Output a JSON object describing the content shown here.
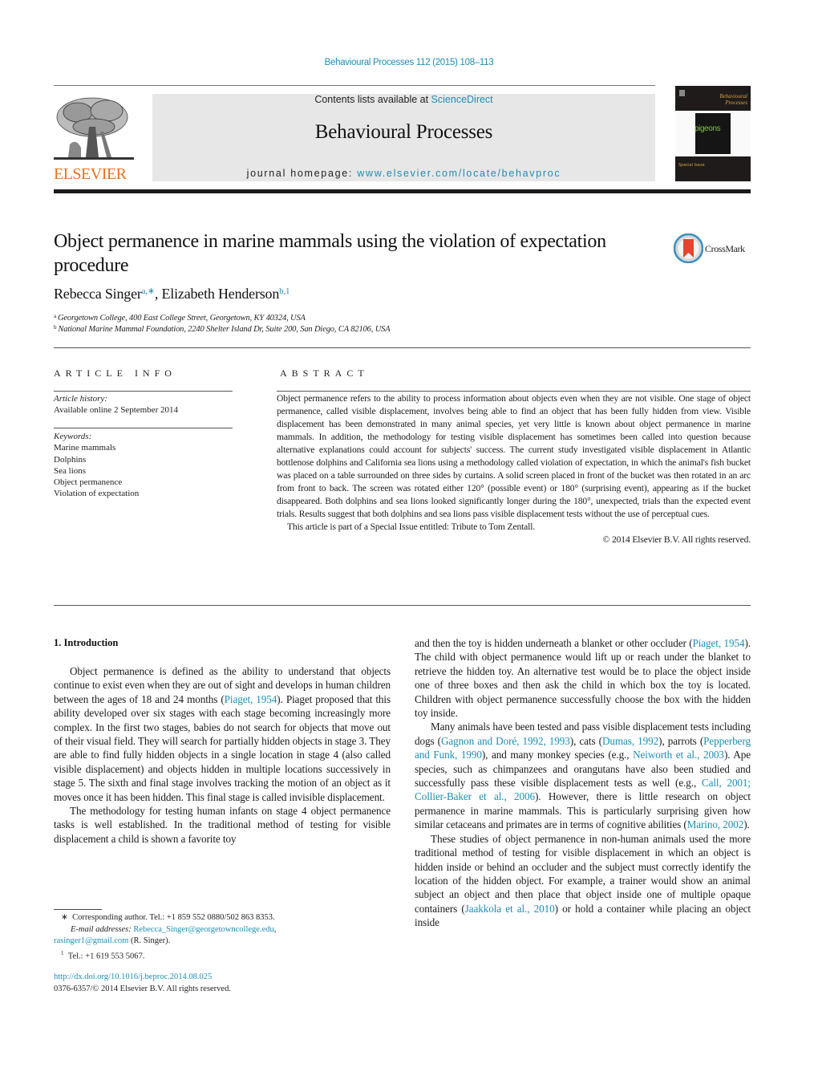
{
  "header": {
    "journal_citation": "Behavioural Processes 112 (2015) 108–113",
    "contents_prefix": "Contents lists available at ",
    "contents_link": "ScienceDirect",
    "journal_name": "Behavioural Processes",
    "homepage_prefix": "journal homepage: ",
    "homepage_link": "www.elsevier.com/locate/behavproc",
    "publisher_logo_text": "ELSEVIER",
    "cover": {
      "title_line1": "Behavioural",
      "title_line2": "Processes",
      "cover_word": "pigeons",
      "special_issue": "Special Issue"
    },
    "colors": {
      "link": "#1f8db5",
      "elsevier_orange": "#e9711c",
      "masthead_bg": "#e7e7e7"
    }
  },
  "article": {
    "title": "Object permanence in marine mammals using the violation of expectation procedure",
    "crossmark_label": "CrossMark",
    "authors": [
      {
        "name": "Rebecca Singer",
        "marks": "a,∗"
      },
      {
        "name": "Elizabeth Henderson",
        "marks": "b,1"
      }
    ],
    "author_separator": ", ",
    "affiliations": [
      {
        "mark": "a",
        "text": "Georgetown College, 400 East College Street, Georgetown, KY 40324, USA"
      },
      {
        "mark": "b",
        "text": "National Marine Mammal Foundation, 2240 Shelter Island Dr, Suite 200, San Diego, CA 82106, USA"
      }
    ]
  },
  "article_info": {
    "label": "ARTICLE INFO",
    "history_label": "Article history:",
    "history_value": "Available online 2 September 2014",
    "keywords_label": "Keywords:",
    "keywords": [
      "Marine mammals",
      "Dolphins",
      "Sea lions",
      "Object permanence",
      "Violation of expectation"
    ]
  },
  "abstract": {
    "label": "ABSTRACT",
    "body": "Object permanence refers to the ability to process information about objects even when they are not visible. One stage of object permanence, called visible displacement, involves being able to find an object that has been fully hidden from view. Visible displacement has been demonstrated in many animal species, yet very little is known about object permanence in marine mammals. In addition, the methodology for testing visible displacement has sometimes been called into question because alternative explanations could account for subjects' success. The current study investigated visible displacement in Atlantic bottlenose dolphins and California sea lions using a methodology called violation of expectation, in which the animal's fish bucket was placed on a table surrounded on three sides by curtains. A solid screen placed in front of the bucket was then rotated in an arc from front to back. The screen was rotated either 120° (possible event) or 180° (surprising event), appearing as if the bucket disappeared. Both dolphins and sea lions looked significantly longer during the 180°, unexpected, trials than the expected event trials. Results suggest that both dolphins and sea lions pass visible displacement tests without the use of perceptual cues.",
    "special_issue": "This article is part of a Special Issue entitled: Tribute to Tom Zentall.",
    "copyright": "© 2014 Elsevier B.V. All rights reserved."
  },
  "introduction": {
    "heading": "1.  Introduction",
    "left_column": [
      [
        {
          "t": "Object permanence is defined as the ability to understand that objects continue to exist even when they are out of sight and develops in human children between the ages of 18 and 24 months ("
        },
        {
          "t": "Piaget, 1954",
          "link": true
        },
        {
          "t": "). Piaget proposed that this ability developed over six stages with each stage becoming increasingly more complex. In the first two stages, babies do not search for objects that move out of their visual field. They will search for partially hidden objects in stage 3. They are able to find fully hidden objects in a single location in stage 4 (also called visible displacement) and objects hidden in multiple locations successively in stage 5. The sixth and final stage involves tracking the motion of an object as it moves once it has been hidden. This final stage is called invisible displacement."
        }
      ],
      [
        {
          "t": "The methodology for testing human infants on stage 4 object permanence tasks is well established. In the traditional method of testing for visible displacement a child is shown a favorite toy"
        }
      ]
    ],
    "right_column": [
      [
        {
          "t": "and then the toy is hidden underneath a blanket or other occluder ("
        },
        {
          "t": "Piaget, 1954",
          "link": true
        },
        {
          "t": "). The child with object permanence would lift up or reach under the blanket to retrieve the hidden toy. An alternative test would be to place the object inside one of three boxes and then ask the child in which box the toy is located. Children with object permanence successfully choose the box with the hidden toy inside."
        }
      ],
      [
        {
          "t": "Many animals have been tested and pass visible displacement tests including dogs ("
        },
        {
          "t": "Gagnon and Doré, 1992, 1993",
          "link": true
        },
        {
          "t": "), cats ("
        },
        {
          "t": "Dumas, 1992",
          "link": true
        },
        {
          "t": "), parrots ("
        },
        {
          "t": "Pepperberg and Funk, 1990",
          "link": true
        },
        {
          "t": "), and many monkey species (e.g., "
        },
        {
          "t": "Neiworth et al., 2003",
          "link": true
        },
        {
          "t": "). Ape species, such as chimpanzees and orangutans have also been studied and successfully pass these visible displacement tests as well (e.g., "
        },
        {
          "t": "Call, 2001; Collier-Baker et al., 2006",
          "link": true
        },
        {
          "t": "). However, there is little research on object permanence in marine mammals. This is particularly surprising given how similar cetaceans and primates are in terms of cognitive abilities ("
        },
        {
          "t": "Marino, 2002",
          "link": true
        },
        {
          "t": ")."
        }
      ],
      [
        {
          "t": "These studies of object permanence in non-human animals used the more traditional method of testing for visible displacement in which an object is hidden inside or behind an occluder and the subject must correctly identify the location of the hidden object. For example, a trainer would show an animal subject an object and then place that object inside one of multiple opaque containers ("
        },
        {
          "t": "Jaakkola et al., 2010",
          "link": true
        },
        {
          "t": ") or hold a container while placing an object inside"
        }
      ]
    ]
  },
  "footnotes": {
    "corresponding_mark": "∗",
    "corresponding_text": "Corresponding author. Tel.: +1 859 552 0880/502 863 8353.",
    "email_label": "E-mail addresses:",
    "email_1": "Rebecca_Singer@georgetowncollege.edu",
    "email_sep": ",",
    "email_2": "rasinger1@gmail.com",
    "email_owner": " (R. Singer).",
    "note1_mark": "1",
    "note1_text": "Tel.: +1 619 553 5067.",
    "doi": "http://dx.doi.org/10.1016/j.beproc.2014.08.025",
    "issn_copyright": "0376-6357/© 2014 Elsevier B.V. All rights reserved."
  }
}
